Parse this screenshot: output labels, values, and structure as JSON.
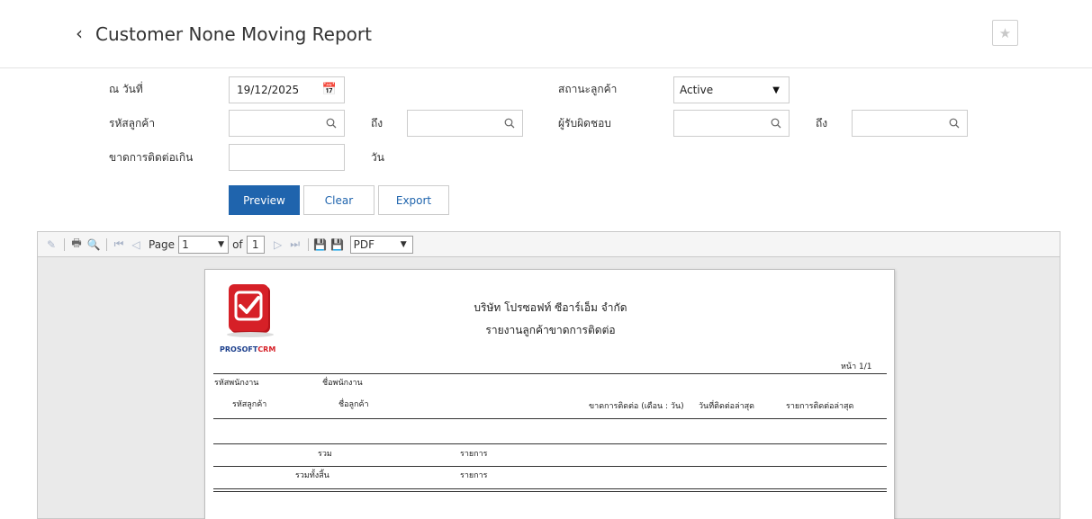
{
  "header": {
    "back_icon": "chevron-left-icon",
    "title": "Customer None Moving Report",
    "star_icon": "star-icon"
  },
  "form": {
    "as_of_label": "ณ วันที่",
    "as_of_value": "19/12/2025",
    "status_label": "สถานะลูกค้า",
    "status_value": "Active",
    "customer_code_label": "รหัสลูกค้า",
    "customer_code_from": "",
    "to_label_1": "ถึง",
    "customer_code_to": "",
    "owner_label": "ผู้รับผิดชอบ",
    "owner_from": "",
    "to_label_2": "ถึง",
    "owner_to": "",
    "no_contact_label": "ขาดการติดต่อเกิน",
    "no_contact_value": "",
    "days_label": "วัน"
  },
  "actions": {
    "preview": "Preview",
    "clear": "Clear",
    "export": "Export"
  },
  "toolbar": {
    "page_label": "Page",
    "page_value": "1",
    "of_label": "of",
    "total_pages": "1",
    "format_value": "PDF"
  },
  "report": {
    "company": "บริษัท โปรซอฟท์ ซีอาร์เอ็ม จำกัด",
    "title": "รายงานลูกค้าขาดการติดต่อ",
    "logo_text_1": "PROSOFT",
    "logo_text_2": "CRM",
    "page_info": "หน้า 1/1",
    "col_emp_code": "รหัสพนักงาน",
    "col_emp_name": "ชื่อพนักงาน",
    "col_cust_code": "รหัสลูกค้า",
    "col_cust_name": "ชื่อลูกค้า",
    "col_no_contact": "ขาดการติดต่อ (เดือน : วัน)",
    "col_last_contact_date": "วันที่ติดต่อล่าสุด",
    "col_last_contact_item": "รายการติดต่อล่าสุด",
    "sum_label": "รวม",
    "sum_unit": "รายการ",
    "grand_label": "รวมทั้งสิ้น",
    "grand_unit": "รายการ"
  },
  "colors": {
    "primary": "#1f64ad",
    "logo_red": "#d62027",
    "logo_blue": "#1c3f8c"
  }
}
